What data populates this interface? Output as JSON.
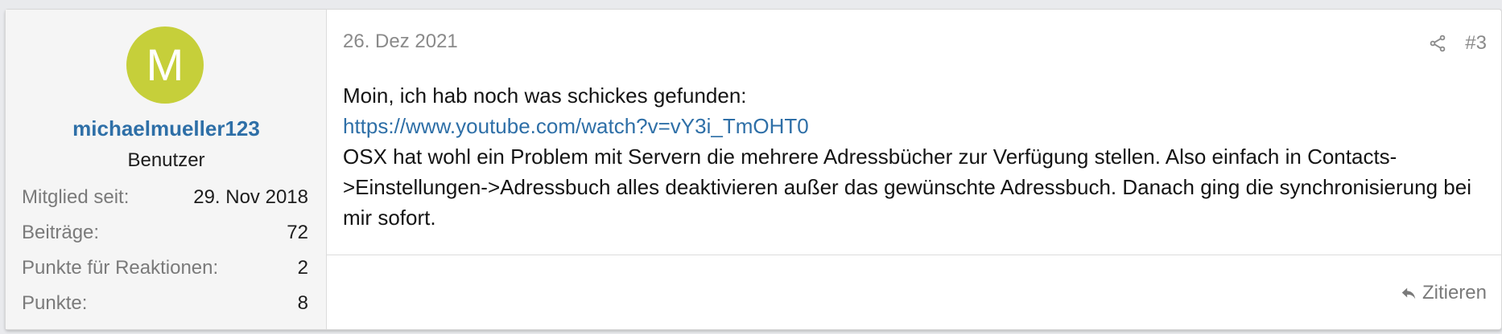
{
  "user": {
    "avatar_letter": "M",
    "avatar_color": "#c6cf3a",
    "username": "michaelmueller123",
    "title": "Benutzer",
    "stats": [
      {
        "label": "Mitglied seit:",
        "value": "29. Nov 2018"
      },
      {
        "label": "Beiträge:",
        "value": "72"
      },
      {
        "label": "Punkte für Reaktionen:",
        "value": "2"
      },
      {
        "label": "Punkte:",
        "value": "8"
      }
    ]
  },
  "post": {
    "date": "26. Dez 2021",
    "number": "#3",
    "share_icon": "share-icon",
    "lines": [
      "Moin, ich hab noch was schickes gefunden:",
      "https://www.youtube.com/watch?v=vY3i_TmOHT0",
      "OSX hat wohl ein Problem mit Servern die mehrere Adressbücher zur Verfügung stellen. Also einfach in Contacts->Einstellungen->Adressbuch alles deaktivieren außer das gewünschte Adressbuch. Danach ging die synchronisierung bei mir sofort."
    ]
  },
  "actions": {
    "quote_label": "Zitieren",
    "quote_icon": "reply-icon"
  },
  "colors": {
    "link": "#2e6fa7",
    "username": "#2e6fa7",
    "muted": "#8a8a8a"
  }
}
